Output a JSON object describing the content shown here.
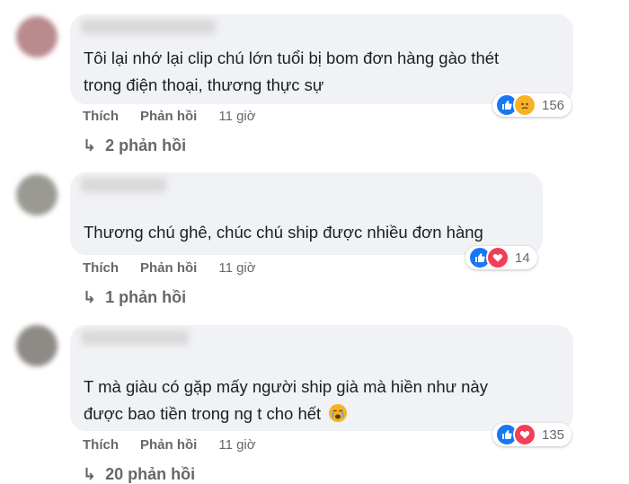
{
  "comments": [
    {
      "text_lines": [
        "Tôi lại nhớ lại clip chú lớn tuổi bị bom đơn hàng gào thét",
        "trong điện thoại, thương thực sự"
      ],
      "like_label": "Thích",
      "reply_label": "Phản hồi",
      "time": "11 giờ",
      "reaction_count": "156",
      "reactions": [
        "like-icon",
        "sad-icon"
      ],
      "replies_label": "2 phản hồi"
    },
    {
      "text_lines": [
        "Thương chú ghê, chúc chú ship được nhiều đơn hàng"
      ],
      "like_label": "Thích",
      "reply_label": "Phản hồi",
      "time": "11 giờ",
      "reaction_count": "14",
      "reactions": [
        "like-icon",
        "heart-icon"
      ],
      "replies_label": "1 phản hồi"
    },
    {
      "text_lines": [
        "T mà giàu có gặp mấy người ship già mà hiền như này",
        "được bao tiền trong ng t cho hết"
      ],
      "like_label": "Thích",
      "reply_label": "Phản hồi",
      "time": "11 giờ",
      "reaction_count": "135",
      "reactions": [
        "like-icon",
        "heart-icon"
      ],
      "replies_label": "20 phản hồi"
    }
  ],
  "colors": {
    "like": "#1877f2",
    "heart": "#f33e58",
    "sad": "#f7b125",
    "bubble": "#f0f2f5",
    "meta_text": "#65676b"
  }
}
